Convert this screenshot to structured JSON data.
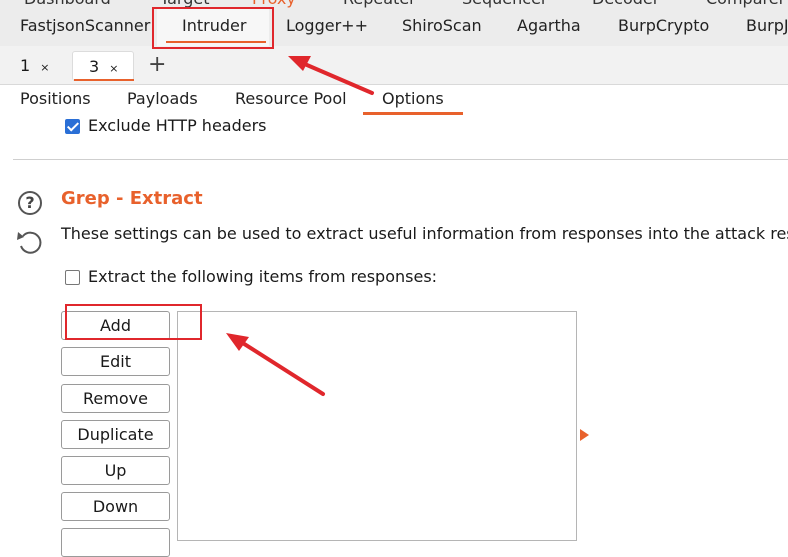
{
  "top_strip": [
    "Dashboard",
    "Target",
    "Proxy",
    "Repeater",
    "Sequencer",
    "Decoder",
    "Comparer"
  ],
  "tool_tabs": [
    "FastjsonScanner",
    "Intruder",
    "Logger++",
    "ShiroScan",
    "Agartha",
    "BurpCrypto",
    "BurpJ"
  ],
  "instance_tabs": [
    {
      "label": "1",
      "close": "×"
    },
    {
      "label": "3",
      "close": "×"
    }
  ],
  "new_tab_label": "+",
  "sub_tabs": [
    "Positions",
    "Payloads",
    "Resource Pool",
    "Options"
  ],
  "exclude_headers": {
    "label": "Exclude HTTP headers",
    "checked": true
  },
  "grep_extract": {
    "help_icon": "?",
    "title": "Grep - Extract",
    "description": "These settings can be used to extract useful information from responses into the attack results",
    "extract_checkbox": {
      "label": "Extract the following items from responses:",
      "checked": false
    },
    "buttons": [
      "Add",
      "Edit",
      "Remove",
      "Duplicate",
      "Up",
      "Down"
    ]
  },
  "icons": {
    "help": "help-circle-icon",
    "reset": "reset-icon",
    "add_tab": "plus-icon",
    "expand": "triangle-right-icon"
  },
  "colors": {
    "accent": "#e8612c",
    "annotation": "#e0272c",
    "checkbox": "#2a6fd6"
  }
}
